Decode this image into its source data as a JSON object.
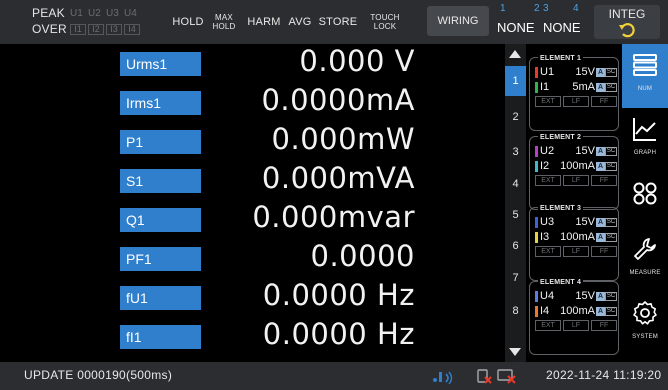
{
  "topbar": {
    "peak_label": "PEAK",
    "over_label": "OVER",
    "peak_channels": [
      "U1",
      "U2",
      "U3",
      "U4"
    ],
    "over_channels": [
      "I1",
      "I2",
      "I3",
      "I4"
    ],
    "hold_label": "HOLD",
    "max_hold_line1": "MAX",
    "max_hold_line2": "HOLD",
    "harm_label": "HARM",
    "avg_label": "AVG",
    "store_label": "STORE",
    "touch_lock_line1": "TOUCH",
    "touch_lock_line2": "LOCK",
    "wiring_label": "WIRING",
    "wiring_numbers": [
      "1",
      "2",
      "3",
      "4"
    ],
    "wiring_values": [
      "NONE",
      "NONE"
    ],
    "integ_label": "INTEG",
    "integ_icon": "reset-arrow-icon"
  },
  "measurements": [
    {
      "label": "Urms1",
      "value": "0.000 V"
    },
    {
      "label": "Irms1",
      "value": "0.0000mA"
    },
    {
      "label": "P1",
      "value": "0.000mW"
    },
    {
      "label": "S1",
      "value": "0.000mVA"
    },
    {
      "label": "Q1",
      "value": "0.000mvar"
    },
    {
      "label": "PF1",
      "value": "0.0000"
    },
    {
      "label": "fU1",
      "value": "0.0000 Hz"
    },
    {
      "label": "fI1",
      "value": "0.0000 Hz"
    }
  ],
  "pages": [
    "1",
    "2",
    "3",
    "4",
    "5",
    "6",
    "7",
    "8"
  ],
  "active_page": "1",
  "elements": [
    {
      "title": "ELEMENT 1",
      "u_name": "U1",
      "u_range": "15V",
      "i_name": "I1",
      "i_range": "5mA",
      "u_color": "#e8392c",
      "i_color": "#2fb34a"
    },
    {
      "title": "ELEMENT 2",
      "u_name": "U2",
      "u_range": "15V",
      "i_name": "I2",
      "i_range": "100mA",
      "u_color": "#b640c9",
      "i_color": "#3fb8c8"
    },
    {
      "title": "ELEMENT 3",
      "u_name": "U3",
      "u_range": "15V",
      "i_name": "I3",
      "i_range": "100mA",
      "u_color": "#3b62d6",
      "i_color": "#e6d23a"
    },
    {
      "title": "ELEMENT 4",
      "u_name": "U4",
      "u_range": "15V",
      "i_name": "I4",
      "i_range": "100mA",
      "u_color": "#5b7fe0",
      "i_color": "#e87a2c"
    }
  ],
  "element_tags": {
    "auto": "A",
    "sc": "SC",
    "filters": [
      "EXT",
      "LF",
      "FF"
    ]
  },
  "nav": [
    {
      "label": "NUM",
      "icon": "numeric-list-icon",
      "active": true
    },
    {
      "label": "GRAPH",
      "icon": "line-graph-icon",
      "active": false
    },
    {
      "label": "",
      "icon": "four-circles-icon",
      "active": false
    },
    {
      "label": "MEASURE",
      "icon": "wrench-icon",
      "active": false
    },
    {
      "label": "SYSTEM",
      "icon": "gear-icon",
      "active": false
    }
  ],
  "status": {
    "update": "UPDATE 0000190(500ms)",
    "datetime": "2022-11-24 11:19:20"
  },
  "colors": {
    "accent": "#2f7fcd",
    "topbar": "#2b2d30",
    "background": "#000000"
  }
}
